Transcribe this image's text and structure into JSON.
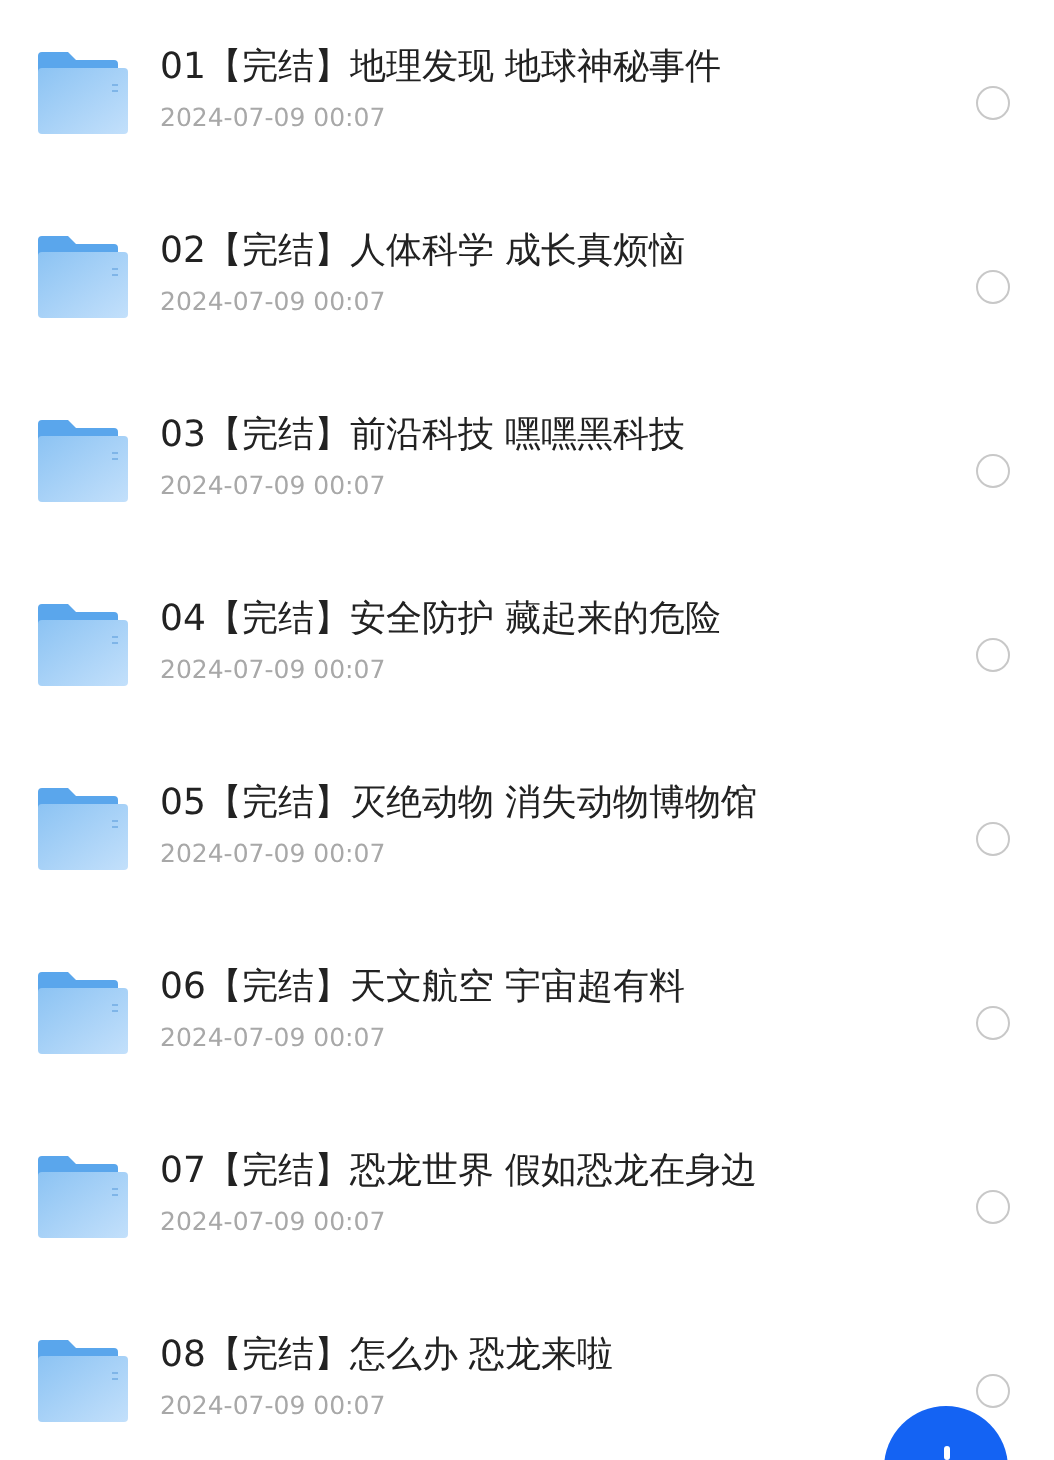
{
  "items": [
    {
      "title": "01【完结】地理发现 地球神秘事件",
      "date": "2024-07-09 00:07",
      "selected": false
    },
    {
      "title": "02【完结】人体科学 成长真烦恼",
      "date": "2024-07-09 00:07",
      "selected": false
    },
    {
      "title": "03【完结】前沿科技 嘿嘿黑科技",
      "date": "2024-07-09 00:07",
      "selected": false
    },
    {
      "title": "04【完结】安全防护 藏起来的危险",
      "date": "2024-07-09 00:07",
      "selected": false
    },
    {
      "title": "05【完结】灭绝动物 消失动物博物馆",
      "date": "2024-07-09 00:07",
      "selected": false
    },
    {
      "title": "06【完结】天文航空 宇宙超有料",
      "date": "2024-07-09 00:07",
      "selected": false
    },
    {
      "title": "07【完结】恐龙世界 假如恐龙在身边",
      "date": "2024-07-09 00:07",
      "selected": false
    },
    {
      "title": "08【完结】怎么办 恐龙来啦",
      "date": "2024-07-09 00:07",
      "selected": false
    }
  ]
}
